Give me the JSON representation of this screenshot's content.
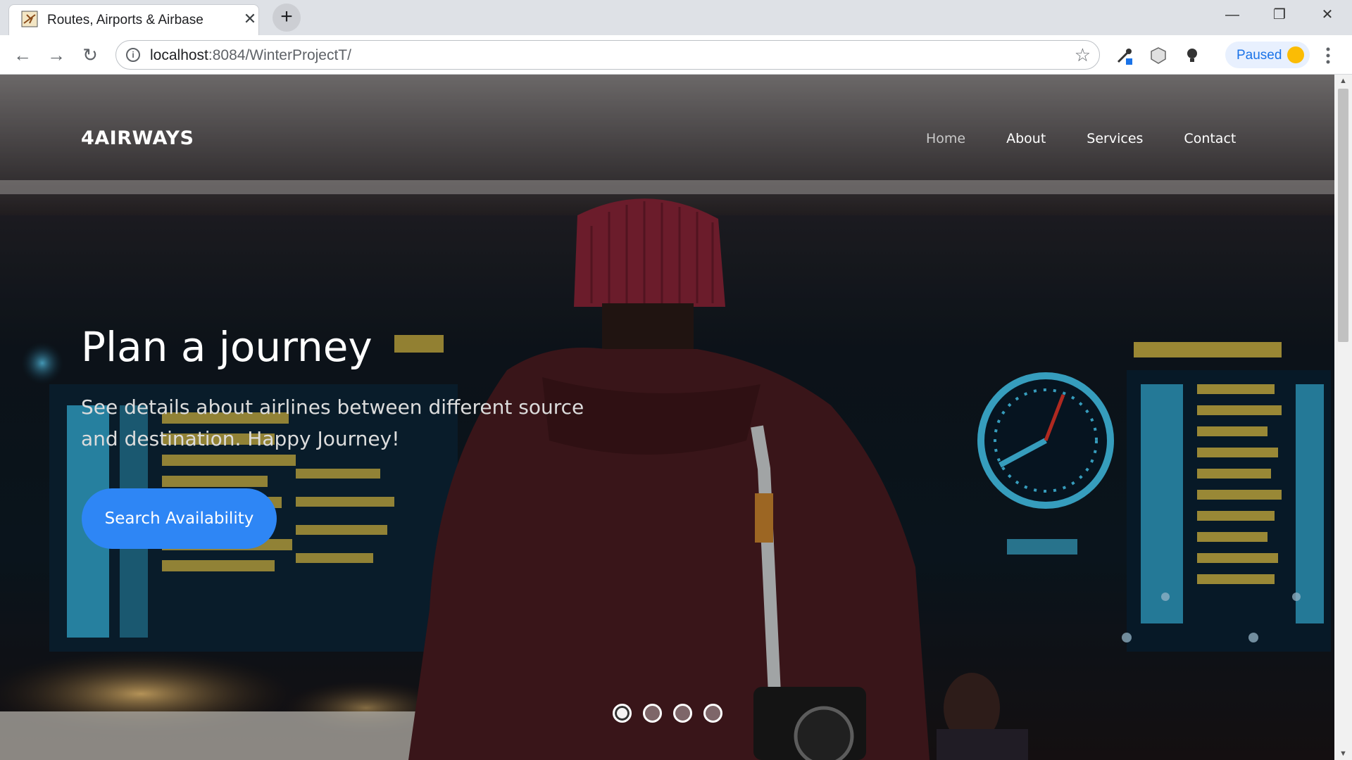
{
  "browser": {
    "tab_title": "Routes, Airports & Airbase",
    "new_tab_symbol": "+",
    "url_host": "localhost",
    "url_rest": ":8084/WinterProjectT/",
    "profile_status": "Paused",
    "icons": [
      "back-arrow-icon",
      "forward-arrow-icon",
      "reload-icon",
      "info-icon",
      "star-icon",
      "extension-icon",
      "shield-icon",
      "bulb-icon",
      "menu-icon"
    ]
  },
  "page": {
    "brand": "4AIRWAYS",
    "nav": [
      {
        "label": "Home",
        "active": true
      },
      {
        "label": "About",
        "active": false
      },
      {
        "label": "Services",
        "active": false
      },
      {
        "label": "Contact",
        "active": false
      }
    ],
    "hero_title": "Plan a journey",
    "hero_text": "See details about airlines between different source and destination. Happy Journey!",
    "cta_label": "Search Availability",
    "carousel": {
      "slides": 4,
      "active_index": 0
    }
  },
  "colors": {
    "cta": "#2e86f5",
    "nav_active": "#c9c9c9",
    "link": "#1a73e8"
  }
}
